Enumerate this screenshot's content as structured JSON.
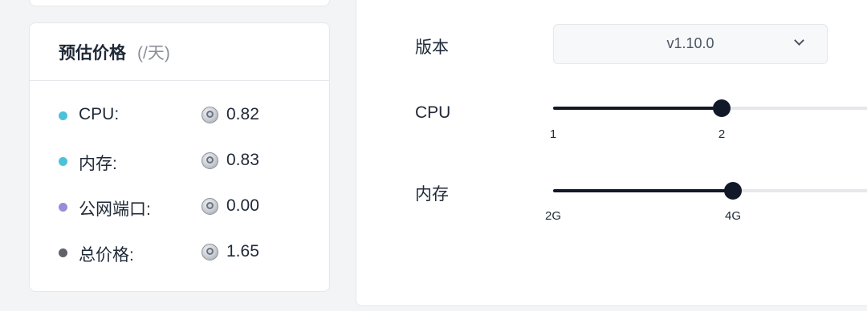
{
  "price_panel": {
    "title": "预估价格",
    "unit": "(/天)",
    "items": [
      {
        "label": "CPU:",
        "value": "0.82",
        "dot_color": "#4cc2d9"
      },
      {
        "label": "内存:",
        "value": "0.83",
        "dot_color": "#4cc2d9"
      },
      {
        "label": "公网端口:",
        "value": "0.00",
        "dot_color": "#9a8cd6"
      },
      {
        "label": "总价格:",
        "value": "1.65",
        "dot_color": "#5f6368"
      }
    ]
  },
  "config_panel": {
    "version": {
      "label": "版本",
      "value": "v1.10.0",
      "icon": "chevron-down-icon"
    },
    "cpu": {
      "label": "CPU",
      "min_label": "1",
      "current_label": "2",
      "level": 0.5
    },
    "memory": {
      "label": "内存",
      "min_label": "2G",
      "current_label": "4G",
      "level": 0.5
    }
  },
  "colors": {
    "accent": "#111827",
    "track": "#e5e7eb",
    "background": "#f3f4f6"
  }
}
